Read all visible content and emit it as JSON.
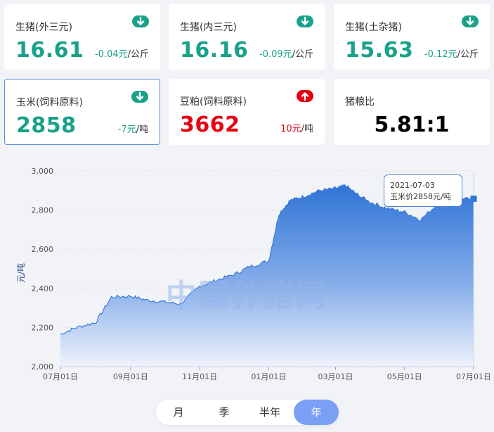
{
  "cards": [
    {
      "label": "生猪(外三元)",
      "value": "16.61",
      "change": "-0.04元",
      "unit": "/公斤",
      "dir": "down"
    },
    {
      "label": "生猪(内三元)",
      "value": "16.16",
      "change": "-0.09元",
      "unit": "/公斤",
      "dir": "down"
    },
    {
      "label": "生猪(土杂猪)",
      "value": "15.63",
      "change": "-0.12元",
      "unit": "/公斤",
      "dir": "down"
    },
    {
      "label": "玉米(饲料原料)",
      "value": "2858",
      "change": "-7元",
      "unit": "/吨",
      "dir": "down"
    },
    {
      "label": "豆粕(饲料原料)",
      "value": "3662",
      "change": "10元",
      "unit": "/吨",
      "dir": "up"
    },
    {
      "label": "猪粮比",
      "value": "5.81:1"
    }
  ],
  "colors": {
    "down": "#1aa18a",
    "up": "#e60012",
    "accent": "#4a86d6",
    "tab_active": "#79a0f5"
  },
  "tooltip": {
    "date": "2021-07-03",
    "text": "玉米价2858元/吨"
  },
  "watermark": "中国养猪网",
  "tabs": [
    "月",
    "季",
    "半年",
    "年"
  ],
  "active_tab": "年",
  "chart_data": {
    "type": "area",
    "ylabel": "元/吨",
    "xlabel": "",
    "ylim": [
      2000,
      3000
    ],
    "yticks": [
      "2,000",
      "2,200",
      "2,400",
      "2,600",
      "2,800",
      "3,000"
    ],
    "xticks": [
      "07月01日",
      "09月01日",
      "11月01日",
      "01月01日",
      "03月01日",
      "05月01日",
      "07月01日"
    ],
    "x": [
      "2020-07-01",
      "2020-07-15",
      "2020-08-01",
      "2020-08-15",
      "2020-09-01",
      "2020-09-15",
      "2020-10-01",
      "2020-10-15",
      "2020-11-01",
      "2020-11-15",
      "2020-12-01",
      "2020-12-15",
      "2021-01-01",
      "2021-01-10",
      "2021-01-20",
      "2021-02-01",
      "2021-02-15",
      "2021-03-01",
      "2021-03-10",
      "2021-03-20",
      "2021-04-01",
      "2021-04-15",
      "2021-05-01",
      "2021-05-15",
      "2021-06-01",
      "2021-06-15",
      "2021-07-03"
    ],
    "values": [
      2165,
      2200,
      2225,
      2355,
      2360,
      2340,
      2330,
      2320,
      2410,
      2440,
      2470,
      2510,
      2540,
      2780,
      2850,
      2870,
      2900,
      2910,
      2925,
      2880,
      2840,
      2810,
      2790,
      2750,
      2840,
      2855,
      2858
    ],
    "grid": true,
    "legend": "none"
  }
}
